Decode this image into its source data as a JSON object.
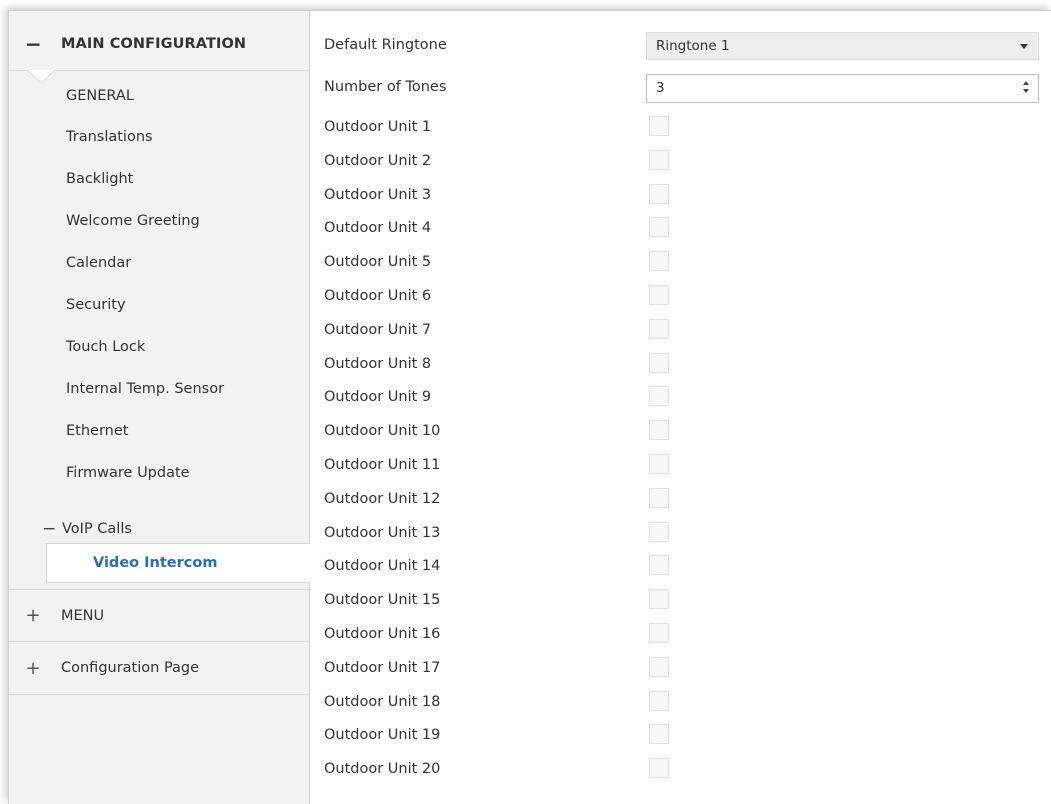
{
  "sidebar": {
    "main_section": {
      "toggle": "−",
      "label": "MAIN CONFIGURATION"
    },
    "items": [
      {
        "label": "GENERAL"
      },
      {
        "label": "Translations"
      },
      {
        "label": "Backlight"
      },
      {
        "label": "Welcome Greeting"
      },
      {
        "label": "Calendar"
      },
      {
        "label": "Security"
      },
      {
        "label": "Touch Lock"
      },
      {
        "label": "Internal Temp. Sensor"
      },
      {
        "label": "Ethernet"
      },
      {
        "label": "Firmware Update"
      }
    ],
    "voip": {
      "toggle": "−",
      "label": "VoIP Calls"
    },
    "video_intercom": {
      "label": "Video Intercom"
    },
    "menu_section": {
      "toggle": "+",
      "label": "MENU"
    },
    "config_section": {
      "toggle": "+",
      "label": "Configuration Page"
    },
    "accent_color": "#2a6db5"
  },
  "content": {
    "default_ringtone": {
      "label": "Default Ringtone",
      "value": "Ringtone 1",
      "icon": "chevron-down-icon"
    },
    "number_of_tones": {
      "label": "Number of Tones",
      "value": "3",
      "icon": "spinner-icon"
    },
    "outdoor_units": [
      {
        "label": "Outdoor Unit 1",
        "checked": false
      },
      {
        "label": "Outdoor Unit 2",
        "checked": false
      },
      {
        "label": "Outdoor Unit 3",
        "checked": false
      },
      {
        "label": "Outdoor Unit 4",
        "checked": false
      },
      {
        "label": "Outdoor Unit 5",
        "checked": false
      },
      {
        "label": "Outdoor Unit 6",
        "checked": false
      },
      {
        "label": "Outdoor Unit 7",
        "checked": false
      },
      {
        "label": "Outdoor Unit 8",
        "checked": false
      },
      {
        "label": "Outdoor Unit 9",
        "checked": false
      },
      {
        "label": "Outdoor Unit 10",
        "checked": false
      },
      {
        "label": "Outdoor Unit 11",
        "checked": false
      },
      {
        "label": "Outdoor Unit 12",
        "checked": false
      },
      {
        "label": "Outdoor Unit 13",
        "checked": false
      },
      {
        "label": "Outdoor Unit 14",
        "checked": false
      },
      {
        "label": "Outdoor Unit 15",
        "checked": false
      },
      {
        "label": "Outdoor Unit 16",
        "checked": false
      },
      {
        "label": "Outdoor Unit 17",
        "checked": false
      },
      {
        "label": "Outdoor Unit 18",
        "checked": false
      },
      {
        "label": "Outdoor Unit 19",
        "checked": false
      },
      {
        "label": "Outdoor Unit 20",
        "checked": false
      }
    ]
  }
}
